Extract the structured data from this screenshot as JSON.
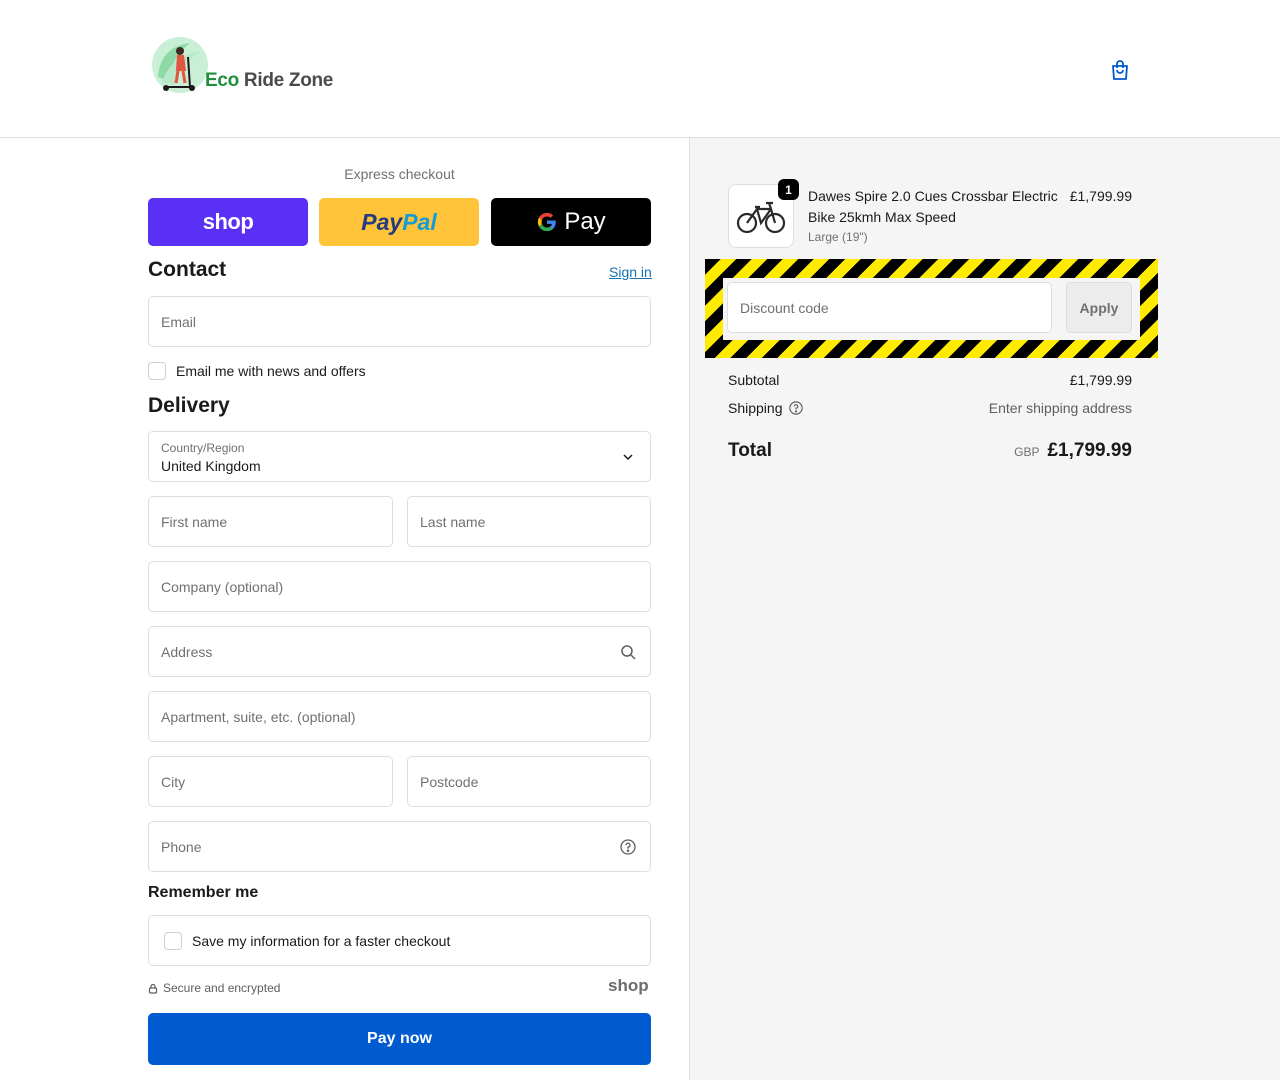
{
  "header": {
    "brand_part1": "Eco",
    "brand_part2": " Ride Zone",
    "cart_icon": "shopping-bag-icon"
  },
  "express": {
    "label": "Express checkout",
    "shop_label": "shop",
    "paypal_part1": "Pay",
    "paypal_part2": "Pal",
    "gpay_label": "Pay"
  },
  "contact": {
    "title": "Contact",
    "sign_in": "Sign in",
    "email_placeholder": "Email",
    "news_label": "Email me with news and offers"
  },
  "delivery": {
    "title": "Delivery",
    "country_label": "Country/Region",
    "country_value": "United Kingdom",
    "first_name": "First name",
    "last_name": "Last name",
    "company": "Company (optional)",
    "address": "Address",
    "apartment": "Apartment, suite, etc. (optional)",
    "city": "City",
    "postcode": "Postcode",
    "phone": "Phone"
  },
  "remember": {
    "title": "Remember me",
    "save_label": "Save my information for a faster checkout"
  },
  "footer": {
    "secure": "Secure and encrypted",
    "shop_brand": "shop",
    "pay_now": "Pay now"
  },
  "summary": {
    "product_name": "Dawes Spire 2.0 Cues Crossbar Electric Bike 25kmh Max Speed",
    "variant": "Large (19\")",
    "price": "£1,799.99",
    "quantity": "1",
    "discount_placeholder": "Discount code",
    "apply_label": "Apply",
    "subtotal_label": "Subtotal",
    "subtotal_value": "£1,799.99",
    "shipping_label": "Shipping",
    "shipping_value": "Enter shipping address",
    "total_label": "Total",
    "currency": "GBP",
    "total_value": "£1,799.99"
  },
  "colors": {
    "shop_purple": "#5a31f4",
    "paypal_yellow": "#ffc439",
    "pay_now_blue": "#005bd1",
    "link_blue": "#1773b0"
  }
}
